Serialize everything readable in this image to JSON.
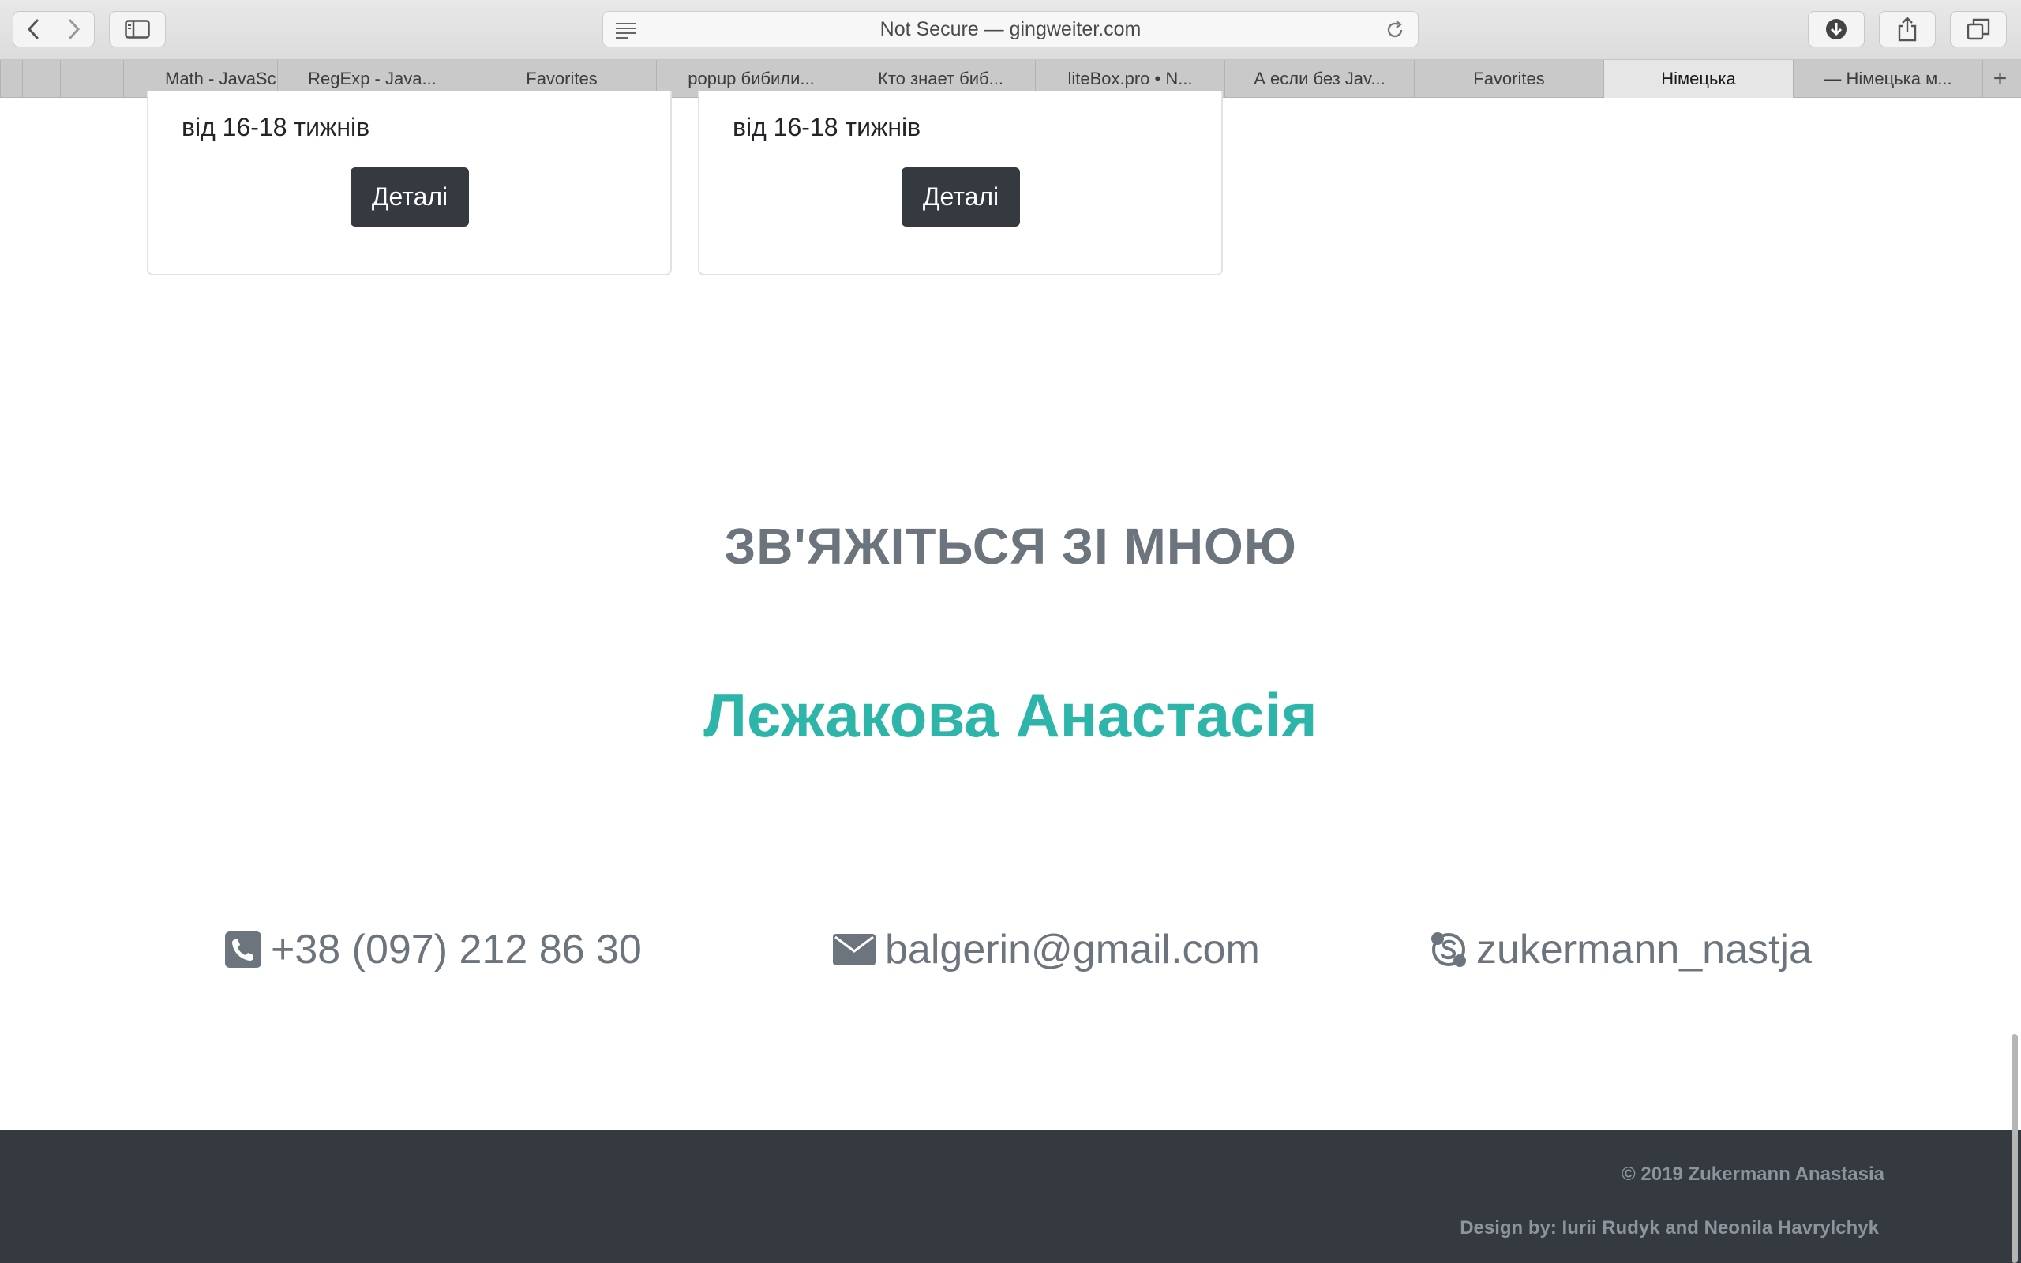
{
  "browser": {
    "address_text": "Not Secure — gingweiter.com",
    "tabs": [
      {
        "label": ""
      },
      {
        "label": ""
      },
      {
        "label": "Math - JavaScript"
      },
      {
        "label": "RegExp - Java..."
      },
      {
        "label": "Favorites"
      },
      {
        "label": "popup бибили..."
      },
      {
        "label": "Кто знает биб..."
      },
      {
        "label": "liteBox.pro • N..."
      },
      {
        "label": "А если без Jav..."
      },
      {
        "label": "Favorites"
      },
      {
        "label": "Німецька"
      },
      {
        "label": "— Німецька м..."
      }
    ],
    "active_tab_index": 10,
    "new_tab_symbol": "+"
  },
  "cards": [
    {
      "duration": "від 16-18 тижнів",
      "button_label": "Деталі"
    },
    {
      "duration": "від 16-18 тижнів",
      "button_label": "Деталі"
    }
  ],
  "contact": {
    "heading": "ЗВ'ЯЖІТЬСЯ ЗІ МНОЮ",
    "name": "Лєжакова Анастасія",
    "phone": "+38 (097) 212 86 30",
    "email": "balgerin@gmail.com",
    "skype": "zukermann_nastja"
  },
  "footer": {
    "copyright": "© 2019 Zukermann Anastasia",
    "design_credit": "Design by:  Iurii Rudyk and Neonila Havrylchyk"
  },
  "colors": {
    "accent": "#2cb5a8",
    "heading_gray": "#6c757d",
    "dark_button": "#343a40",
    "footer_bg": "#343a40"
  }
}
